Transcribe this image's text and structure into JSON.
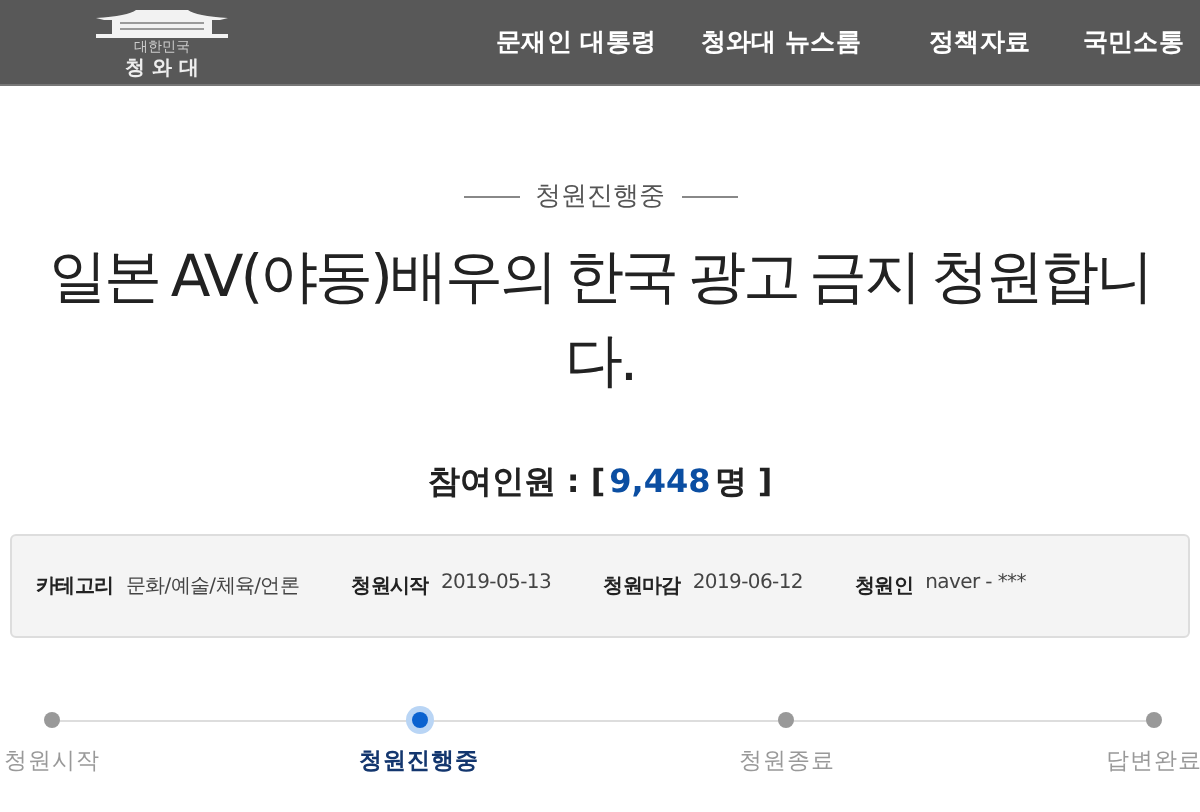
{
  "header": {
    "logo": {
      "small_text": "대한민국",
      "name": "청 와 대"
    },
    "nav": [
      {
        "label": "문재인 대통령"
      },
      {
        "label": "청와대 뉴스룸"
      },
      {
        "label": "정책자료"
      },
      {
        "label": "국민소통"
      }
    ]
  },
  "status": "청원진행중",
  "title": "일본 AV(야동)배우의 한국 광고 금지 청원합니다.",
  "participants": {
    "label": "참여인원 : [",
    "count": "9,448",
    "unit": "명 ]"
  },
  "info": [
    {
      "label": "카테고리",
      "value": "문화/예술/체육/언론"
    },
    {
      "label": "청원시작",
      "value": "2019-05-13"
    },
    {
      "label": "청원마감",
      "value": "2019-06-12"
    },
    {
      "label": "청원인",
      "value": "naver - ***"
    }
  ],
  "steps": [
    {
      "label": "청원시작",
      "selected": false
    },
    {
      "label": "청원진행중",
      "selected": true
    },
    {
      "label": "청원종료",
      "selected": false
    },
    {
      "label": "답변완료",
      "selected": false
    }
  ]
}
